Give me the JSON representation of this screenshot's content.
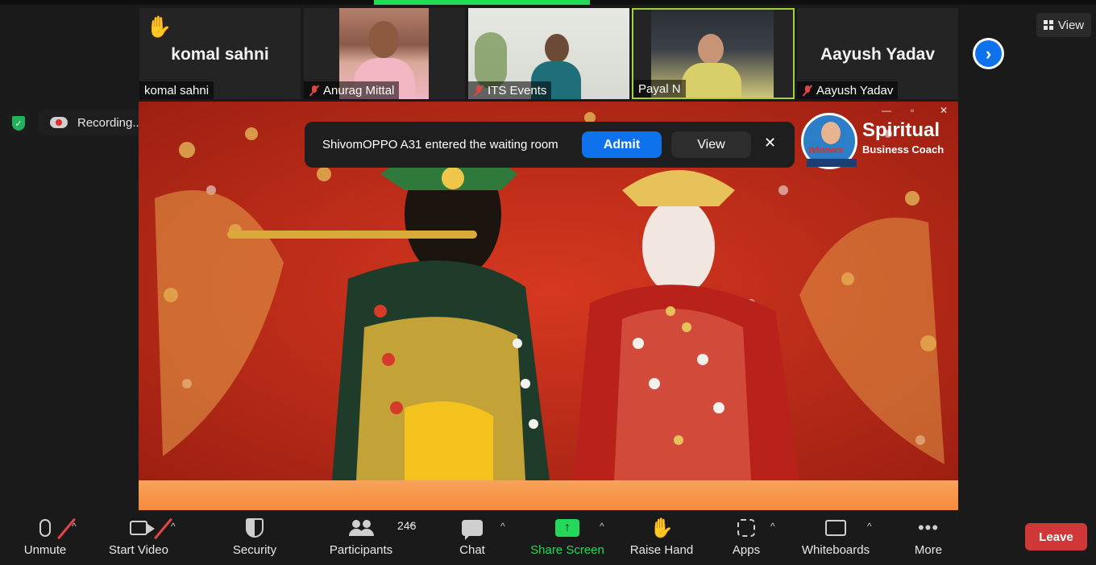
{
  "thumbnails": [
    {
      "big_name": "komal sahni",
      "label": "komal sahni"
    },
    {
      "label": "Anurag Mittal"
    },
    {
      "label": "ITS Events"
    },
    {
      "label": "Payal N"
    },
    {
      "big_name": "Aayush Yadav",
      "label": "Aayush Yadav"
    }
  ],
  "view_button": "View",
  "recording": {
    "label": "Recording..."
  },
  "notification": {
    "message": "ShivomOPPO A31 entered the waiting room",
    "admit": "Admit",
    "view": "View",
    "close": "✕"
  },
  "logo": {
    "line1": "Spiritual",
    "line2": "Business Coach",
    "badge": "Winners"
  },
  "toolbar": {
    "unmute": "Unmute",
    "start_video": "Start Video",
    "security": "Security",
    "participants": "Participants",
    "participant_count": "246",
    "chat": "Chat",
    "share_screen": "Share Screen",
    "raise_hand": "Raise Hand",
    "apps": "Apps",
    "whiteboards": "Whiteboards",
    "more": "More",
    "leave": "Leave"
  },
  "colors": {
    "accent": "#0e72ed",
    "share": "#23d959",
    "leave": "#d03838",
    "muted": "#e04646"
  }
}
